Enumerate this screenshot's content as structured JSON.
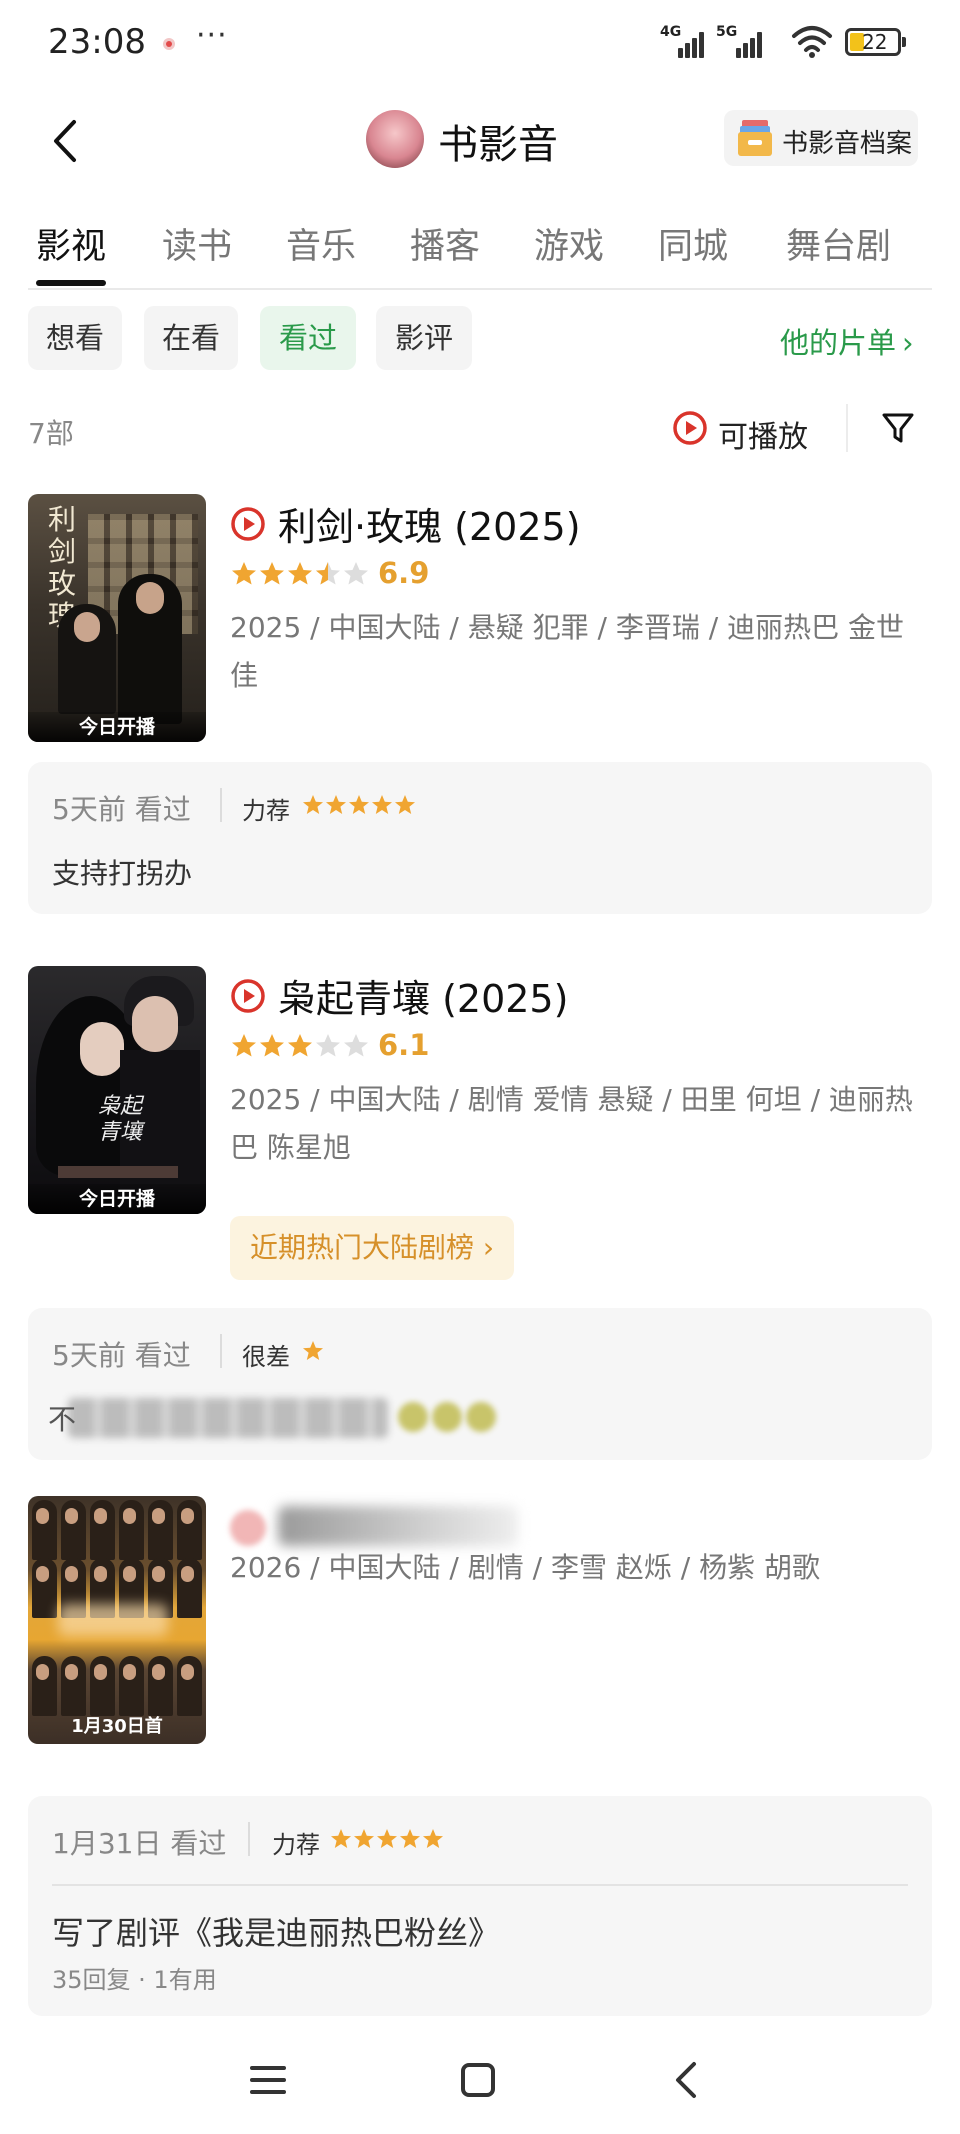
{
  "status_bar": {
    "time": "23:08",
    "more": "···",
    "signal_1": "4G",
    "signal_2": "5G",
    "battery": "22"
  },
  "header": {
    "title": "书影音",
    "archive_label": "书影音档案"
  },
  "tabs": [
    {
      "label": "影视",
      "active": true
    },
    {
      "label": "读书"
    },
    {
      "label": "音乐"
    },
    {
      "label": "播客"
    },
    {
      "label": "游戏"
    },
    {
      "label": "同城"
    },
    {
      "label": "舞台剧"
    }
  ],
  "filters": {
    "chips": [
      {
        "label": "想看"
      },
      {
        "label": "在看"
      },
      {
        "label": "看过",
        "active": true
      },
      {
        "label": "影评"
      }
    ],
    "his_list": "他的片单"
  },
  "summary": {
    "count": "7部",
    "playable": "可播放"
  },
  "items": [
    {
      "title": "利剑·玫瑰 (2025)",
      "poster_title": "利剑玫瑰",
      "poster_caption": "今日开播",
      "rating_stars": 3.5,
      "score": "6.9",
      "meta": "2025 / 中国大陆 / 悬疑 犯罪 / 李晋瑞 / 迪丽热巴 金世佳",
      "watched": "5天前 看过",
      "recommend": "力荐",
      "user_stars": 5,
      "comment": "支持打拐办"
    },
    {
      "title": "枭起青壤 (2025)",
      "poster_title": "枭起青壤",
      "poster_caption": "今日开播",
      "rating_stars": 3,
      "score": "6.1",
      "meta": "2025 / 中国大陆 / 剧情 爱情 悬疑 / 田里 何坦 / 迪丽热巴 陈星旭",
      "hotlist": "近期热门大陆剧榜",
      "watched": "5天前 看过",
      "recommend": "很差",
      "user_stars": 1,
      "comment_visible": "不"
    },
    {
      "meta": "2026 / 中国大陆 / 剧情 / 李雪 赵烁 / 杨紫 胡歌",
      "poster_caption": "1月30日首",
      "watched": "1月31日 看过",
      "recommend": "力荐",
      "user_stars": 5,
      "review": "写了剧评《我是迪丽热巴粉丝》",
      "review_meta": "35回复 · 1有用"
    }
  ],
  "colors": {
    "accent_green": "#2a9a4a",
    "star_orange": "#f0a531",
    "play_red": "#d9342b",
    "hot_orange": "#d6902a"
  },
  "icons": [
    "back-icon",
    "archive-icon",
    "play-circle-icon",
    "filter-icon",
    "menu-icon",
    "home-icon",
    "back-nav-icon"
  ]
}
